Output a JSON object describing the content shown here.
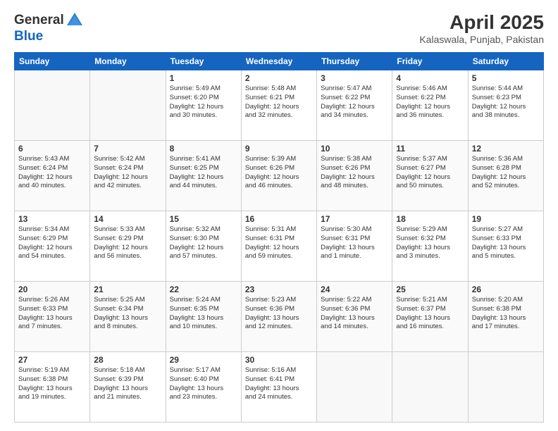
{
  "header": {
    "logo_line1": "General",
    "logo_line2": "Blue",
    "month": "April 2025",
    "location": "Kalaswala, Punjab, Pakistan"
  },
  "days_of_week": [
    "Sunday",
    "Monday",
    "Tuesday",
    "Wednesday",
    "Thursday",
    "Friday",
    "Saturday"
  ],
  "weeks": [
    [
      {
        "day": "",
        "info": ""
      },
      {
        "day": "",
        "info": ""
      },
      {
        "day": "1",
        "info": "Sunrise: 5:49 AM\nSunset: 6:20 PM\nDaylight: 12 hours\nand 30 minutes."
      },
      {
        "day": "2",
        "info": "Sunrise: 5:48 AM\nSunset: 6:21 PM\nDaylight: 12 hours\nand 32 minutes."
      },
      {
        "day": "3",
        "info": "Sunrise: 5:47 AM\nSunset: 6:22 PM\nDaylight: 12 hours\nand 34 minutes."
      },
      {
        "day": "4",
        "info": "Sunrise: 5:46 AM\nSunset: 6:22 PM\nDaylight: 12 hours\nand 36 minutes."
      },
      {
        "day": "5",
        "info": "Sunrise: 5:44 AM\nSunset: 6:23 PM\nDaylight: 12 hours\nand 38 minutes."
      }
    ],
    [
      {
        "day": "6",
        "info": "Sunrise: 5:43 AM\nSunset: 6:24 PM\nDaylight: 12 hours\nand 40 minutes."
      },
      {
        "day": "7",
        "info": "Sunrise: 5:42 AM\nSunset: 6:24 PM\nDaylight: 12 hours\nand 42 minutes."
      },
      {
        "day": "8",
        "info": "Sunrise: 5:41 AM\nSunset: 6:25 PM\nDaylight: 12 hours\nand 44 minutes."
      },
      {
        "day": "9",
        "info": "Sunrise: 5:39 AM\nSunset: 6:26 PM\nDaylight: 12 hours\nand 46 minutes."
      },
      {
        "day": "10",
        "info": "Sunrise: 5:38 AM\nSunset: 6:26 PM\nDaylight: 12 hours\nand 48 minutes."
      },
      {
        "day": "11",
        "info": "Sunrise: 5:37 AM\nSunset: 6:27 PM\nDaylight: 12 hours\nand 50 minutes."
      },
      {
        "day": "12",
        "info": "Sunrise: 5:36 AM\nSunset: 6:28 PM\nDaylight: 12 hours\nand 52 minutes."
      }
    ],
    [
      {
        "day": "13",
        "info": "Sunrise: 5:34 AM\nSunset: 6:29 PM\nDaylight: 12 hours\nand 54 minutes."
      },
      {
        "day": "14",
        "info": "Sunrise: 5:33 AM\nSunset: 6:29 PM\nDaylight: 12 hours\nand 56 minutes."
      },
      {
        "day": "15",
        "info": "Sunrise: 5:32 AM\nSunset: 6:30 PM\nDaylight: 12 hours\nand 57 minutes."
      },
      {
        "day": "16",
        "info": "Sunrise: 5:31 AM\nSunset: 6:31 PM\nDaylight: 12 hours\nand 59 minutes."
      },
      {
        "day": "17",
        "info": "Sunrise: 5:30 AM\nSunset: 6:31 PM\nDaylight: 13 hours\nand 1 minute."
      },
      {
        "day": "18",
        "info": "Sunrise: 5:29 AM\nSunset: 6:32 PM\nDaylight: 13 hours\nand 3 minutes."
      },
      {
        "day": "19",
        "info": "Sunrise: 5:27 AM\nSunset: 6:33 PM\nDaylight: 13 hours\nand 5 minutes."
      }
    ],
    [
      {
        "day": "20",
        "info": "Sunrise: 5:26 AM\nSunset: 6:33 PM\nDaylight: 13 hours\nand 7 minutes."
      },
      {
        "day": "21",
        "info": "Sunrise: 5:25 AM\nSunset: 6:34 PM\nDaylight: 13 hours\nand 8 minutes."
      },
      {
        "day": "22",
        "info": "Sunrise: 5:24 AM\nSunset: 6:35 PM\nDaylight: 13 hours\nand 10 minutes."
      },
      {
        "day": "23",
        "info": "Sunrise: 5:23 AM\nSunset: 6:36 PM\nDaylight: 13 hours\nand 12 minutes."
      },
      {
        "day": "24",
        "info": "Sunrise: 5:22 AM\nSunset: 6:36 PM\nDaylight: 13 hours\nand 14 minutes."
      },
      {
        "day": "25",
        "info": "Sunrise: 5:21 AM\nSunset: 6:37 PM\nDaylight: 13 hours\nand 16 minutes."
      },
      {
        "day": "26",
        "info": "Sunrise: 5:20 AM\nSunset: 6:38 PM\nDaylight: 13 hours\nand 17 minutes."
      }
    ],
    [
      {
        "day": "27",
        "info": "Sunrise: 5:19 AM\nSunset: 6:38 PM\nDaylight: 13 hours\nand 19 minutes."
      },
      {
        "day": "28",
        "info": "Sunrise: 5:18 AM\nSunset: 6:39 PM\nDaylight: 13 hours\nand 21 minutes."
      },
      {
        "day": "29",
        "info": "Sunrise: 5:17 AM\nSunset: 6:40 PM\nDaylight: 13 hours\nand 23 minutes."
      },
      {
        "day": "30",
        "info": "Sunrise: 5:16 AM\nSunset: 6:41 PM\nDaylight: 13 hours\nand 24 minutes."
      },
      {
        "day": "",
        "info": ""
      },
      {
        "day": "",
        "info": ""
      },
      {
        "day": "",
        "info": ""
      }
    ]
  ]
}
